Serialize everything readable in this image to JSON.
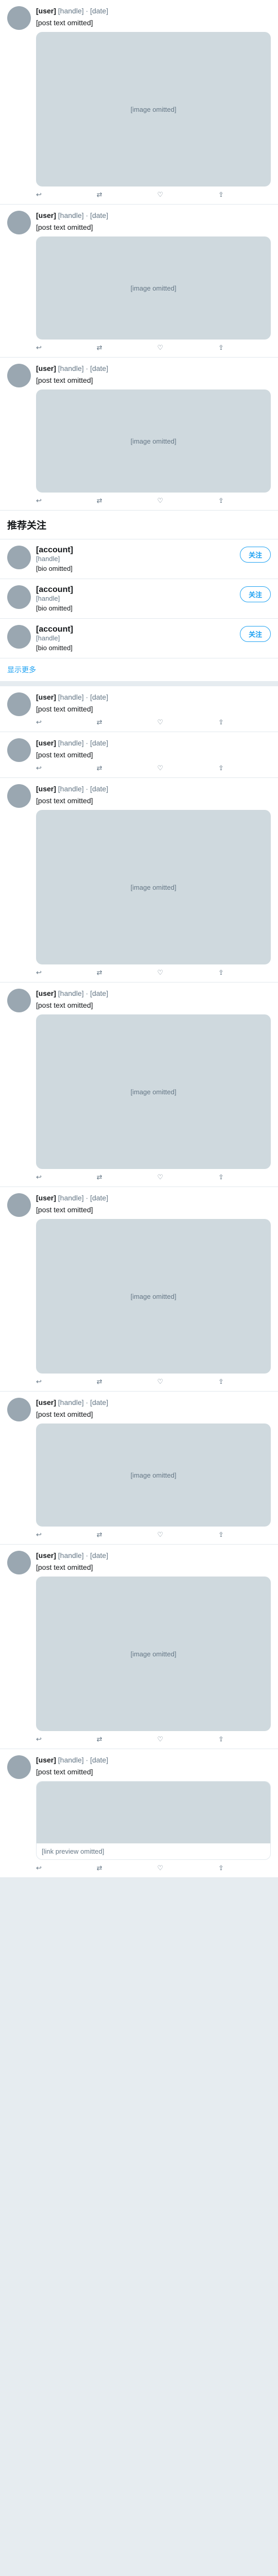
{
  "notice": "",
  "colors": {
    "accent": "#1da1f2",
    "like": "#e0245e",
    "muted": "#657786"
  },
  "posts_top": [
    {
      "name": "[user]",
      "meta": "[handle] · [date]",
      "text": "[post text omitted]",
      "media_label": "[image omitted]",
      "replies": "",
      "retweets": "",
      "likes": ""
    },
    {
      "name": "[user]",
      "meta": "[handle] · [date]",
      "text": "[post text omitted]",
      "media_label": "[image omitted]",
      "replies": "",
      "retweets": "",
      "likes": ""
    },
    {
      "name": "[user]",
      "meta": "[handle] · [date]",
      "text": "[post text omitted]",
      "media_label": "[image omitted]",
      "replies": "",
      "retweets": "",
      "likes": ""
    }
  ],
  "who_to_follow": {
    "title": "推荐关注",
    "follow_label": "关注",
    "items": [
      {
        "name": "[account]",
        "handle": "[handle]",
        "bio": "[bio omitted]"
      },
      {
        "name": "[account]",
        "handle": "[handle]",
        "bio": "[bio omitted]"
      },
      {
        "name": "[account]",
        "handle": "[handle]",
        "bio": "[bio omitted]"
      }
    ],
    "show_more": "显示更多"
  },
  "posts_bottom": [
    {
      "name": "[user]",
      "meta": "[handle] · [date]",
      "text": "[post text omitted]",
      "media_label": "",
      "replies": "",
      "retweets": "",
      "likes": ""
    },
    {
      "name": "[user]",
      "meta": "[handle] · [date]",
      "text": "[post text omitted]",
      "media_label": "",
      "replies": "",
      "retweets": "",
      "likes": ""
    },
    {
      "name": "[user]",
      "meta": "[handle] · [date]",
      "text": "[post text omitted]",
      "media_label": "[image omitted]",
      "replies": "",
      "retweets": "",
      "likes": ""
    },
    {
      "name": "[user]",
      "meta": "[handle] · [date]",
      "text": "[post text omitted]",
      "media_label": "[image omitted]",
      "replies": "",
      "retweets": "",
      "likes": ""
    },
    {
      "name": "[user]",
      "meta": "[handle] · [date]",
      "text": "[post text omitted]",
      "media_label": "[image omitted]",
      "replies": "",
      "retweets": "",
      "likes": ""
    },
    {
      "name": "[user]",
      "meta": "[handle] · [date]",
      "text": "[post text omitted]",
      "media_label": "[image omitted]",
      "replies": "",
      "retweets": "",
      "likes": ""
    },
    {
      "name": "[user]",
      "meta": "[handle] · [date]",
      "text": "[post text omitted]",
      "media_label": "[image omitted]",
      "replies": "",
      "retweets": "",
      "likes": ""
    },
    {
      "name": "[user]",
      "meta": "[handle] · [date]",
      "text": "[post text omitted]",
      "media_label": "",
      "link_text": "[link preview omitted]",
      "replies": "",
      "retweets": "",
      "likes": ""
    }
  ]
}
